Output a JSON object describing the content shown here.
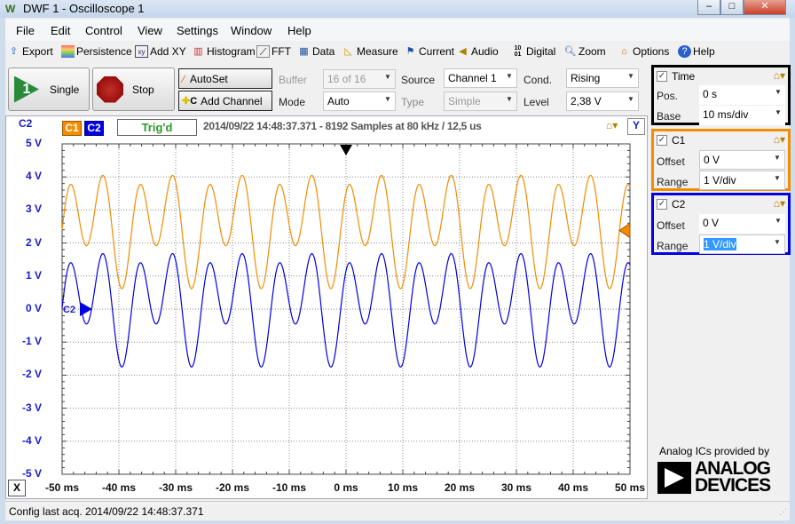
{
  "window": {
    "title": "DWF 1 - Oscilloscope 1",
    "controls": [
      "minimize",
      "maximize",
      "close"
    ]
  },
  "menu": [
    "File",
    "Edit",
    "Control",
    "View",
    "Settings",
    "Window",
    "Help"
  ],
  "toolbar": [
    {
      "label": "Export",
      "icon": "export-icon"
    },
    {
      "label": "Persistence",
      "icon": "persistence-icon"
    },
    {
      "label": "Add XY",
      "icon": "xy-icon"
    },
    {
      "label": "Histogram",
      "icon": "histogram-icon"
    },
    {
      "label": "FFT",
      "icon": "fft-icon"
    },
    {
      "label": "Data",
      "icon": "table-icon"
    },
    {
      "label": "Measure",
      "icon": "ruler-icon"
    },
    {
      "label": "Current",
      "icon": "current-icon"
    },
    {
      "label": "Audio",
      "icon": "speaker-icon"
    },
    {
      "label": "Digital",
      "icon": "digital-icon"
    },
    {
      "label": "Zoom",
      "icon": "magnifier-icon"
    },
    {
      "label": "Options",
      "icon": "options-icon"
    },
    {
      "label": "Help",
      "icon": "help-icon"
    }
  ],
  "controls": {
    "single": "Single",
    "stop": "Stop",
    "autoset": "AutoSet",
    "add_channel": "Add Channel",
    "buffer_label": "Buffer",
    "buffer_value": "16 of 16",
    "mode_label": "Mode",
    "mode_value": "Auto",
    "source_label": "Source",
    "source_value": "Channel 1",
    "type_label": "Type",
    "type_value": "Simple",
    "cond_label": "Cond.",
    "cond_value": "Rising",
    "level_label": "Level",
    "level_value": "2,38 V"
  },
  "panels": {
    "time": {
      "title": "Time",
      "checked": true,
      "pos_label": "Pos.",
      "pos_value": "0 s",
      "base_label": "Base",
      "base_value": "10 ms/div",
      "color": "#000000"
    },
    "c1": {
      "title": "C1",
      "checked": true,
      "offset_label": "Offset",
      "offset_value": "0 V",
      "range_label": "Range",
      "range_value": "1 V/div",
      "color": "#f28c00"
    },
    "c2": {
      "title": "C2",
      "checked": true,
      "offset_label": "Offset",
      "offset_value": "0 V",
      "range_label": "Range",
      "range_value": "1 V/div",
      "color": "#0000e0"
    }
  },
  "scope": {
    "axis_channel": "C2",
    "c1_tag": "C1",
    "c2_tag": "C2",
    "status": "Trig'd",
    "info": "2014/09/22 14:48:37.371 - 8192 Samples at 80 kHz / 12,5 us",
    "y_button": "Y",
    "x_button": "X",
    "c2_marker": "C2"
  },
  "chart_data": {
    "type": "line",
    "x_ticks": [
      "-50 ms",
      "-40 ms",
      "-30 ms",
      "-20 ms",
      "-10 ms",
      "0 ms",
      "10 ms",
      "20 ms",
      "30 ms",
      "40 ms",
      "50 ms"
    ],
    "y_ticks": [
      "5 V",
      "4 V",
      "3 V",
      "2 V",
      "1 V",
      "0 V",
      "-1 V",
      "-2 V",
      "-3 V",
      "-4 V",
      "-5 V"
    ],
    "xlim_ms": [
      -50,
      50
    ],
    "ylim_v": [
      -5,
      5
    ],
    "grid": true,
    "trigger_time_ms": 0,
    "trigger_level_v": 2.38,
    "series": [
      {
        "name": "C1",
        "color": "#f28c00",
        "period_ms": 12.27,
        "dc_v": 2.57,
        "fundamental_v": 0.665,
        "second_harmonic_v": 1.3,
        "second_harmonic_phase_rad": 3.56,
        "trough_time_ms": -2.3
      },
      {
        "name": "C2",
        "color": "#0000e0",
        "period_ms": 12.27,
        "dc_v": 0.2,
        "fundamental_v": 0.665,
        "second_harmonic_v": 1.3,
        "second_harmonic_phase_rad": 3.56,
        "trough_time_ms": -2.3
      }
    ]
  },
  "logo": {
    "caption": "Analog ICs provided by",
    "brand": "ANALOG DEVICES"
  },
  "statusbar": "Config last acq. 2014/09/22  14:48:37.371"
}
